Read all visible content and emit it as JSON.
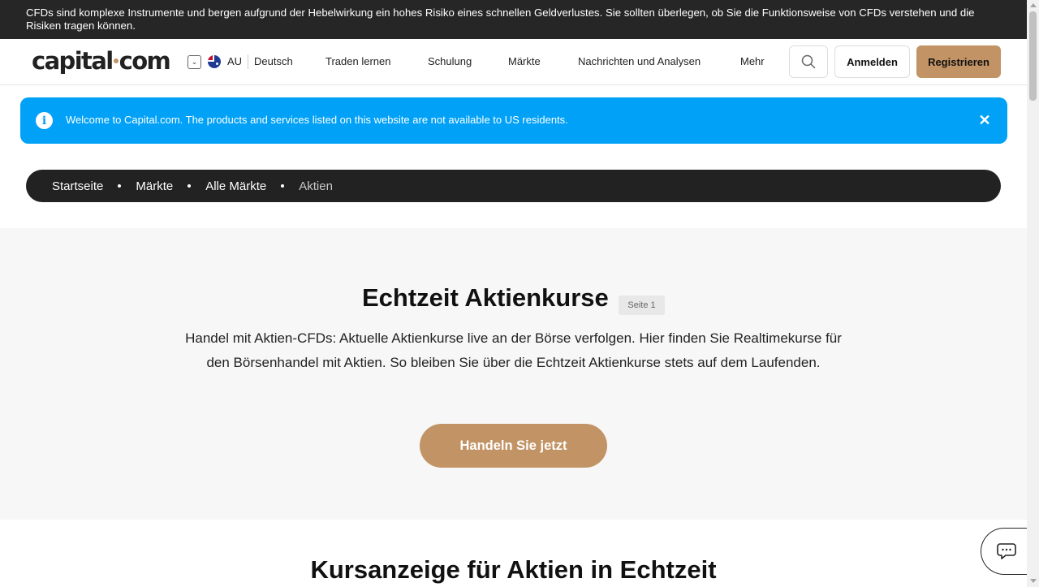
{
  "risk_warning": "CFDs sind komplexe Instrumente und bergen aufgrund der Hebelwirkung ein hohes Risiko eines schnellen Geldverlustes. Sie sollten überlegen, ob Sie die Funktionsweise von CFDs verstehen und die Risiken tragen können.",
  "header": {
    "logo_left": "capital",
    "logo_right": "com",
    "region": "AU",
    "language": "Deutsch",
    "nav": [
      "Traden lernen",
      "Schulung",
      "Märkte",
      "Nachrichten und Analysen",
      "Mehr"
    ],
    "login_label": "Anmelden",
    "register_label": "Registrieren"
  },
  "info_banner": {
    "text": "Welcome to Capital.com. The products and services listed on this website are not available to US residents."
  },
  "breadcrumb": [
    "Startseite",
    "Märkte",
    "Alle Märkte",
    "Aktien"
  ],
  "hero": {
    "title": "Echtzeit Aktienkurse",
    "page_tag": "Seite 1",
    "description": "Handel mit Aktien-CFDs: Aktuelle Aktienkurse live an der Börse verfolgen. Hier finden Sie Realtimekurse für den Börsenhandel mit Aktien. So bleiben Sie über die Echtzeit Aktienkurse stets auf dem Laufenden.",
    "cta_label": "Handeln Sie jetzt"
  },
  "section_title": "Kursanzeige für Aktien in Echtzeit",
  "colors": {
    "accent": "#c29364",
    "info": "#00a1f7",
    "dark": "#262626"
  }
}
